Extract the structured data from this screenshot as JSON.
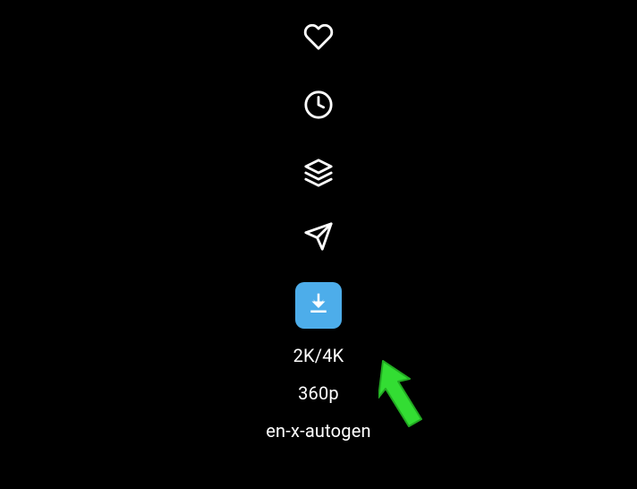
{
  "icons": {
    "heart": "heart-icon",
    "clock": "clock-icon",
    "layers": "layers-icon",
    "send": "send-icon",
    "download": "download-icon"
  },
  "options": {
    "quality_high": "2K/4K",
    "quality_low": "360p",
    "caption_lang": "en-x-autogen"
  },
  "colors": {
    "download_bg": "#4DADEA",
    "arrow_fill": "#33DD33",
    "arrow_stroke": "#22AA22"
  }
}
